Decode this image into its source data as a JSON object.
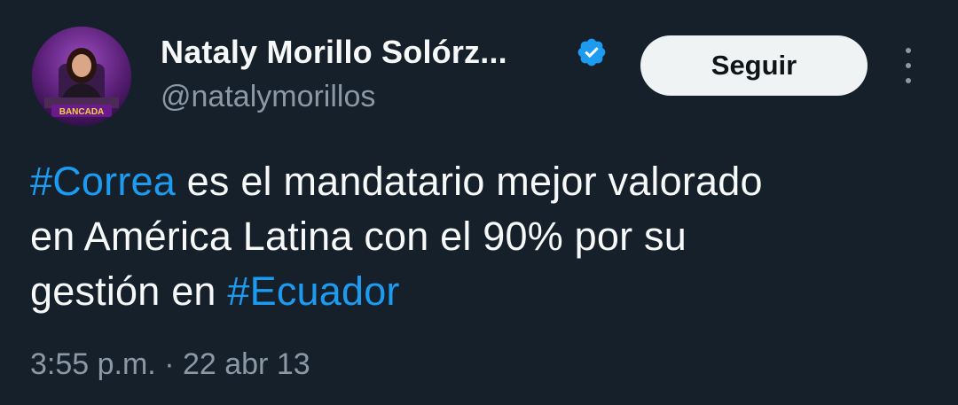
{
  "author": {
    "name": "Nataly Morillo Solórz...",
    "handle": "@natalymorillos",
    "verified": true,
    "avatar_badge_text": "BANCADA"
  },
  "actions": {
    "follow_label": "Seguir",
    "more_icon": "more-vertical-icon"
  },
  "tweet": {
    "line1_hashtag": "#Correa",
    "line1_text": " es el mandatario mejor valorado",
    "line2_text": "en América Latina con el 90% por su",
    "line3_text": "gestión en ",
    "line3_hashtag": "#Ecuador"
  },
  "meta": {
    "time": "3:55 p.m.",
    "separator": " · ",
    "date": "22 abr 13"
  },
  "colors": {
    "background": "#15202b",
    "text": "#f7f9f9",
    "secondary": "#8b98a5",
    "link": "#1d9bf0",
    "verified": "#1d9bf0",
    "button_bg": "#eff3f4"
  }
}
